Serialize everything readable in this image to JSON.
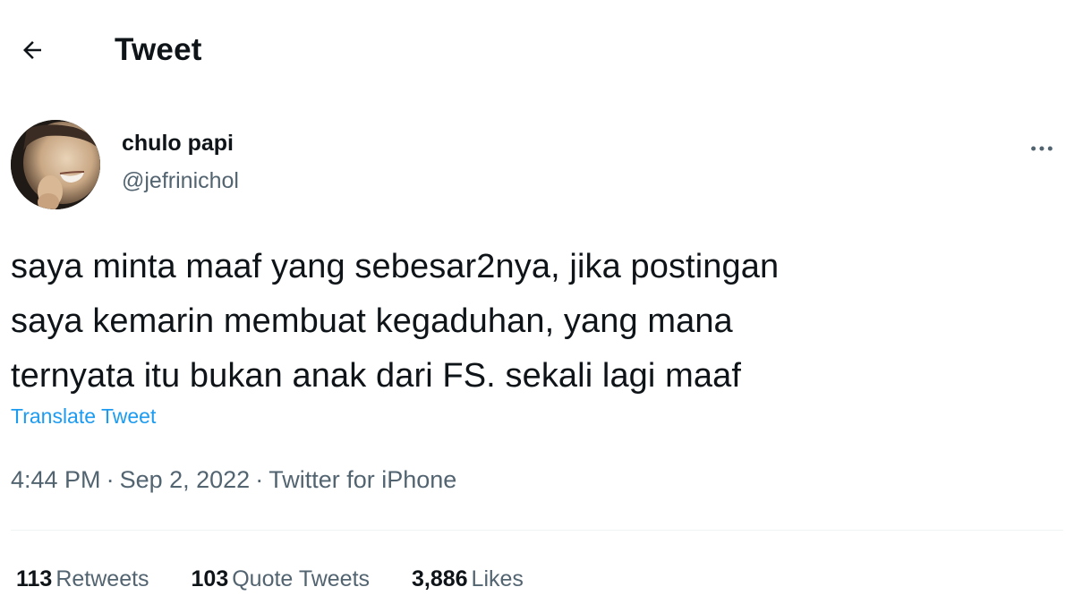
{
  "header": {
    "back_icon": "arrow-left-icon",
    "title": "Tweet"
  },
  "author": {
    "display_name": "chulo papi",
    "handle": "@jefrinichol",
    "more_icon": "more-horizontal-icon"
  },
  "tweet": {
    "text": "saya minta maaf yang sebesar2nya, jika postingan\nsaya kemarin membuat kegaduhan, yang mana\nternyata itu bukan anak dari FS. sekali lagi maaf",
    "translate_label": "Translate Tweet",
    "time": "4:44 PM",
    "separator": "·",
    "date": "Sep 2, 2022",
    "source": "Twitter for iPhone"
  },
  "stats": {
    "retweets": {
      "count": "113",
      "label": "Retweets"
    },
    "quote_tweets": {
      "count": "103",
      "label": "Quote Tweets"
    },
    "likes": {
      "count": "3,886",
      "label": "Likes"
    }
  },
  "colors": {
    "text_primary": "#0f1419",
    "text_secondary": "#536471",
    "link": "#1d9bf0",
    "divider": "#eff3f4"
  }
}
